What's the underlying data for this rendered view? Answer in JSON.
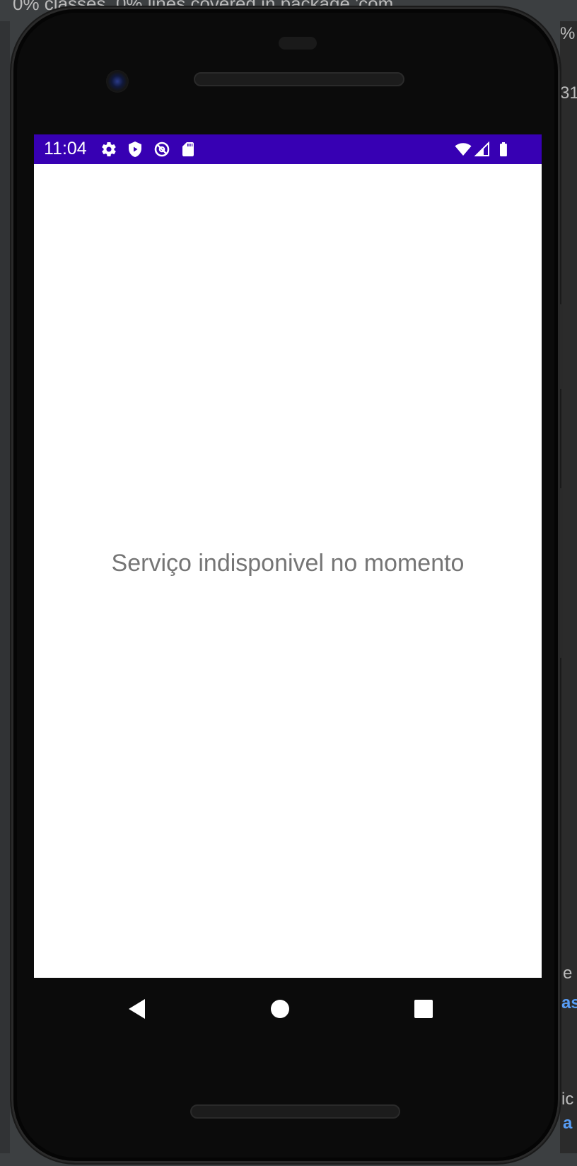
{
  "ide": {
    "top_text": "0% classes, 0% lines covered in package 'com.",
    "right_texts": [
      "%",
      "31",
      "e",
      "ic"
    ],
    "right_links": [
      "as",
      "a"
    ]
  },
  "status_bar": {
    "time": "11:04",
    "background_color": "#3700b3",
    "left_icons": [
      "settings-icon",
      "play-protect-icon",
      "data-saver-icon",
      "sd-card-icon"
    ],
    "right_icons": [
      "wifi-icon",
      "signal-icon",
      "battery-icon"
    ]
  },
  "main": {
    "message": "Serviço indisponivel no momento"
  },
  "nav_bar": {
    "buttons": [
      "back-icon",
      "home-icon",
      "recents-icon"
    ]
  }
}
